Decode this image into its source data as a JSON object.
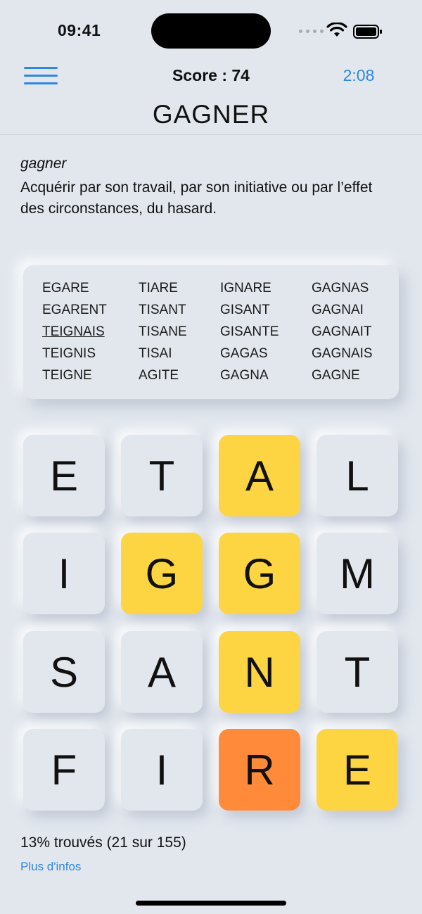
{
  "status": {
    "time": "09:41"
  },
  "header": {
    "score": "Score : 74",
    "timer": "2:08",
    "current_word": "GAGNER"
  },
  "definition": {
    "word": "gagner",
    "text": "Acquérir par son travail, par son initiative ou par l’effet des circonstances, du hasard."
  },
  "found_words": [
    [
      "EGARE",
      "EGARENT",
      "TEIGNAIS",
      "TEIGNIS",
      "TEIGNE"
    ],
    [
      "TIARE",
      "TISANT",
      "TISANE",
      "TISAI",
      "AGITE"
    ],
    [
      "IGNARE",
      "GISANT",
      "GISANTE",
      "GAGAS",
      "GAGNA"
    ],
    [
      "GAGNAS",
      "GAGNAI",
      "GAGNAIT",
      "GAGNAIS",
      "GAGNE"
    ]
  ],
  "underlined_word": "TEIGNAIS",
  "grid": [
    [
      {
        "letter": "E",
        "state": "normal"
      },
      {
        "letter": "T",
        "state": "normal"
      },
      {
        "letter": "A",
        "state": "yellow"
      },
      {
        "letter": "L",
        "state": "normal"
      }
    ],
    [
      {
        "letter": "I",
        "state": "normal"
      },
      {
        "letter": "G",
        "state": "yellow"
      },
      {
        "letter": "G",
        "state": "yellow"
      },
      {
        "letter": "M",
        "state": "normal"
      }
    ],
    [
      {
        "letter": "S",
        "state": "normal"
      },
      {
        "letter": "A",
        "state": "normal"
      },
      {
        "letter": "N",
        "state": "yellow"
      },
      {
        "letter": "T",
        "state": "normal"
      }
    ],
    [
      {
        "letter": "F",
        "state": "normal"
      },
      {
        "letter": "I",
        "state": "normal"
      },
      {
        "letter": "R",
        "state": "orange"
      },
      {
        "letter": "E",
        "state": "yellow"
      }
    ]
  ],
  "footer": {
    "progress": "13% trouvés (21 sur 155)",
    "more_info": "Plus d'infos"
  },
  "colors": {
    "accent": "#2f86e6",
    "tile_yellow": "#fdd543",
    "tile_orange": "#ff8a3a",
    "background": "#e2e7ee"
  }
}
